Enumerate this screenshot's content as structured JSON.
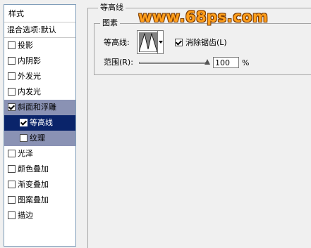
{
  "styles_panel": {
    "header": "样式",
    "blending_options": "混合选项:默认",
    "items": [
      {
        "label": "投影",
        "checked": false
      },
      {
        "label": "内阴影",
        "checked": false
      },
      {
        "label": "外发光",
        "checked": false
      },
      {
        "label": "内发光",
        "checked": false
      },
      {
        "label": "斜面和浮雕",
        "checked": true
      },
      {
        "label": "等高线",
        "checked": true
      },
      {
        "label": "纹理",
        "checked": false
      },
      {
        "label": "光泽",
        "checked": false
      },
      {
        "label": "颜色叠加",
        "checked": false
      },
      {
        "label": "渐变叠加",
        "checked": false
      },
      {
        "label": "图案叠加",
        "checked": false
      },
      {
        "label": "描边",
        "checked": false
      }
    ]
  },
  "contour": {
    "group_title": "等高线",
    "elements_title": "图素",
    "contour_label": "等高线:",
    "anti_alias_label": "消除锯齿(L)",
    "anti_alias_checked": true,
    "range_label": "范围(R):",
    "range_value": "100",
    "range_unit": "%",
    "range_fraction": 1.0
  },
  "watermark": "www.68ps.com",
  "colors": {
    "selected_bg": "#0a246a",
    "active_bg": "#8a92b4",
    "watermark": "#ff9f1c"
  }
}
